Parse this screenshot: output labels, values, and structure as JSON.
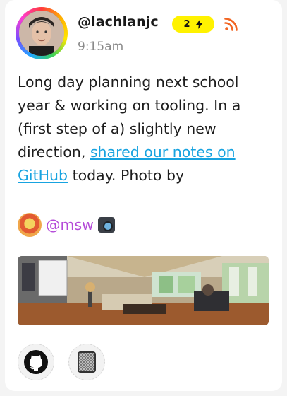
{
  "post": {
    "handle": "@lachlanjc",
    "badge_count": "2",
    "badge_icon": "lightning-icon",
    "time": "9:15am",
    "text_before_link": "Long day planning next school year & working on tooling. In a (first step of a) slightly new direction, ",
    "link_text": "shared our notes on GitHub",
    "text_after_link": " today. Photo by",
    "mention": "@msw"
  },
  "colors": {
    "badge": "#fff200",
    "link": "#17a3e0",
    "mention": "#b44ad8",
    "rss": "#f26522"
  },
  "actions": [
    {
      "icon": "github-icon"
    },
    {
      "icon": "checker-square-icon"
    }
  ]
}
